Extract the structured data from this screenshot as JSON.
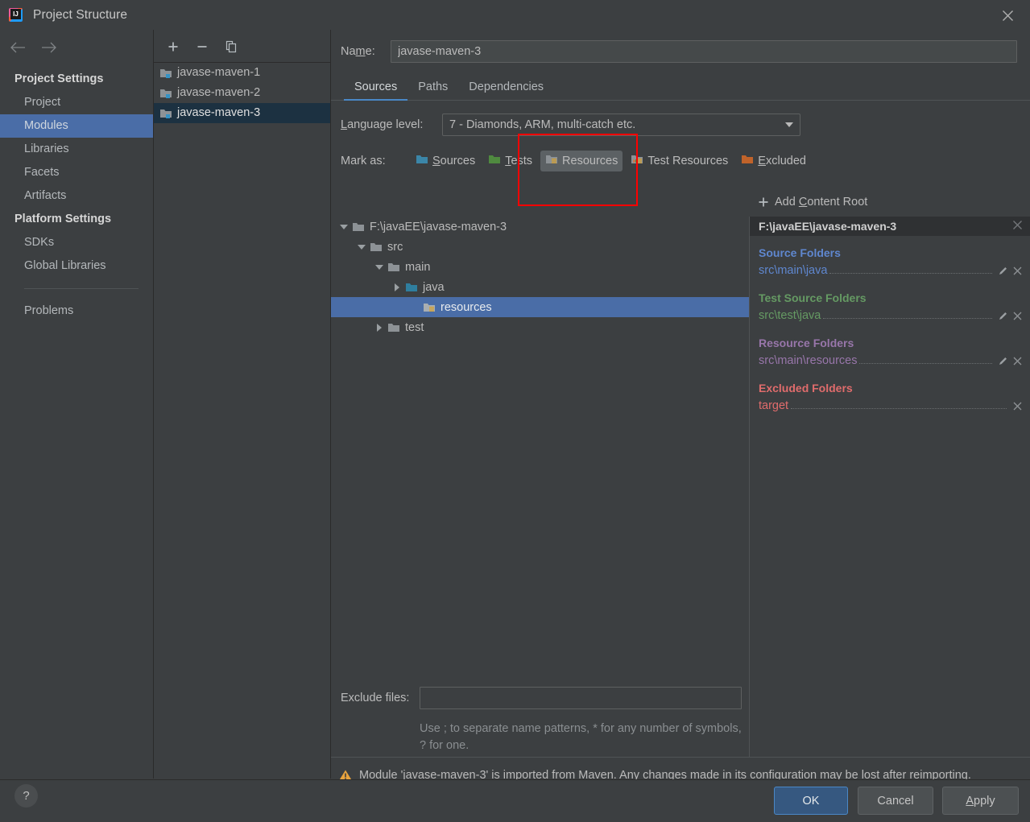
{
  "window": {
    "title": "Project Structure",
    "app_icon": "intellij-idea-icon",
    "close_icon": "close-icon"
  },
  "sidebar": {
    "back_icon": "arrow-left-icon",
    "forward_icon": "arrow-right-icon",
    "groups": [
      {
        "label": "Project Settings",
        "items": [
          {
            "label": "Project",
            "selected": false
          },
          {
            "label": "Modules",
            "selected": true
          },
          {
            "label": "Libraries",
            "selected": false
          },
          {
            "label": "Facets",
            "selected": false
          },
          {
            "label": "Artifacts",
            "selected": false
          }
        ]
      },
      {
        "label": "Platform Settings",
        "items": [
          {
            "label": "SDKs",
            "selected": false
          },
          {
            "label": "Global Libraries",
            "selected": false
          }
        ]
      }
    ],
    "problems_label": "Problems"
  },
  "modules_pane": {
    "toolbar": {
      "add_icon": "plus-icon",
      "remove_icon": "minus-icon",
      "copy_icon": "copy-icon"
    },
    "items": [
      {
        "label": "javase-maven-1",
        "selected": false
      },
      {
        "label": "javase-maven-2",
        "selected": false
      },
      {
        "label": "javase-maven-3",
        "selected": true
      }
    ]
  },
  "main": {
    "name_label": "Name:",
    "name_label_pre": "Na",
    "name_label_mnemonic": "m",
    "name_label_post": "e:",
    "name_value": "javase-maven-3",
    "tabs": [
      {
        "label": "Sources",
        "active": true
      },
      {
        "label": "Paths",
        "active": false
      },
      {
        "label": "Dependencies",
        "active": false
      }
    ],
    "language_level_label": "Language level:",
    "language_level_mnemonic": "L",
    "language_level_label_rest": "anguage level:",
    "language_level_value": "7 - Diamonds, ARM, multi-catch etc.",
    "mark_as_label": "Mark as:",
    "mark_as_buttons": [
      {
        "label": "Sources",
        "mnemonic": "S",
        "rest": "ources",
        "icon": "folder-sources-icon",
        "pressed": false
      },
      {
        "label": "Tests",
        "mnemonic": "T",
        "rest": "ests",
        "icon": "folder-tests-icon",
        "pressed": false
      },
      {
        "label": "Resources",
        "mnemonic": "",
        "rest": "Resources",
        "icon": "folder-resources-icon",
        "pressed": true
      },
      {
        "label": "Test Resources",
        "mnemonic": "",
        "rest": "Test Resources",
        "icon": "folder-test-resources-icon",
        "pressed": false
      },
      {
        "label": "Excluded",
        "mnemonic": "E",
        "rest": "xcluded",
        "icon": "folder-excluded-icon",
        "pressed": false
      }
    ],
    "tree": [
      {
        "label": "F:\\javaEE\\javase-maven-3",
        "depth": 0,
        "twisty": "down",
        "icon": "folder-plain-icon",
        "selected": false
      },
      {
        "label": "src",
        "depth": 1,
        "twisty": "down",
        "icon": "folder-plain-icon",
        "selected": false
      },
      {
        "label": "main",
        "depth": 2,
        "twisty": "down",
        "icon": "folder-plain-icon",
        "selected": false
      },
      {
        "label": "java",
        "depth": 3,
        "twisty": "right",
        "icon": "folder-sources-icon",
        "selected": false
      },
      {
        "label": "resources",
        "depth": 4,
        "twisty": "none",
        "icon": "folder-resources-icon",
        "selected": true
      },
      {
        "label": "test",
        "depth": 2,
        "twisty": "right",
        "icon": "folder-plain-icon",
        "selected": false
      }
    ],
    "exclude_files_label": "Exclude files:",
    "exclude_files_value": "",
    "exclude_hint": "Use ; to separate name patterns, * for any number of symbols, ? for one.",
    "warning_icon": "warning-triangle-icon",
    "warning_text": "Module 'javase-maven-3' is imported from Maven. Any changes made in its configuration may be lost after reimporting."
  },
  "content_roots": {
    "add_content_root_label": "Add Content Root",
    "add_icon": "plus-icon",
    "root_path": "F:\\javaEE\\javase-maven-3",
    "root_remove_icon": "close-icon",
    "groups": [
      {
        "title": "Source Folders",
        "kind": "src",
        "color": "#5f87cf",
        "entries": [
          {
            "path": "src\\main\\java",
            "edit_icon": "pencil-icon",
            "remove_icon": "close-icon",
            "has_edit": true
          }
        ]
      },
      {
        "title": "Test Source Folders",
        "kind": "test",
        "color": "#659a63",
        "entries": [
          {
            "path": "src\\test\\java",
            "edit_icon": "pencil-icon",
            "remove_icon": "close-icon",
            "has_edit": true
          }
        ]
      },
      {
        "title": "Resource Folders",
        "kind": "res",
        "color": "#9876aa",
        "entries": [
          {
            "path": "src\\main\\resources",
            "edit_icon": "pencil-icon",
            "remove_icon": "close-icon",
            "has_edit": true
          }
        ]
      },
      {
        "title": "Excluded Folders",
        "kind": "exc",
        "color": "#e06c6c",
        "entries": [
          {
            "path": "target",
            "edit_icon": "",
            "remove_icon": "close-icon",
            "has_edit": false
          }
        ]
      }
    ]
  },
  "annotation": {
    "type": "highlight-rectangle",
    "color": "#ff0000"
  },
  "footer": {
    "help_icon": "help-question-icon",
    "help_label": "?",
    "ok_label": "OK",
    "cancel_label": "Cancel",
    "apply_label": "Apply",
    "apply_mnemonic": "A",
    "apply_rest": "pply"
  },
  "theme": {
    "background": "#3c3f41",
    "selection_blue": "#4a6da7",
    "list_selection": "#1c3141",
    "accent": "#4a88c7",
    "border": "#2b2b2b",
    "text": "#bbbbbb"
  }
}
